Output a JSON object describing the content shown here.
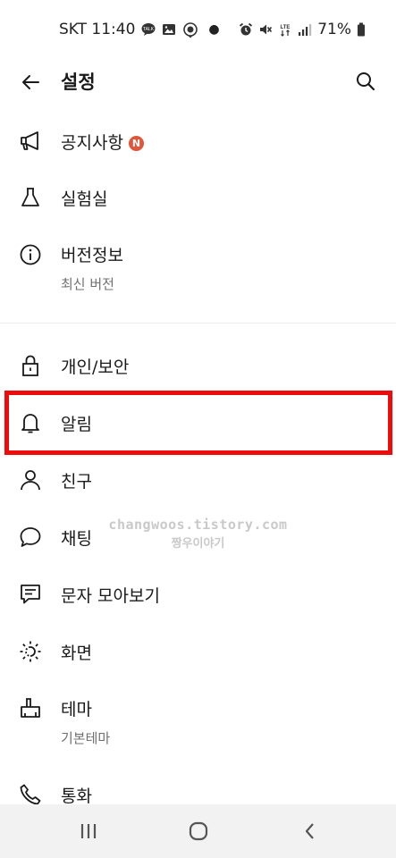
{
  "status_bar": {
    "carrier_time": "SKT 11:40",
    "battery": "71%",
    "notification_icons": [
      "talk-icon",
      "image-icon",
      "location-face-icon"
    ],
    "system_icons": [
      "alarm-icon",
      "mute-icon",
      "lte-icon",
      "signal-icon",
      "battery-icon"
    ]
  },
  "header": {
    "title": "설정"
  },
  "menu": {
    "notice": {
      "label": "공지사항",
      "badge": "N"
    },
    "lab": {
      "label": "실험실"
    },
    "version": {
      "label": "버전정보",
      "sub": "최신 버전"
    },
    "privacy": {
      "label": "개인/보안"
    },
    "alarm": {
      "label": "알림"
    },
    "friends": {
      "label": "친구"
    },
    "chat": {
      "label": "채팅"
    },
    "sms": {
      "label": "문자 모아보기"
    },
    "display": {
      "label": "화면"
    },
    "theme": {
      "label": "테마",
      "sub": "기본테마"
    },
    "call": {
      "label": "통화"
    }
  },
  "watermark": {
    "line1": "changwoos.tistory.com",
    "line2": "짱우이야기"
  },
  "colors": {
    "highlight": "#ee0b0b",
    "badge": "#e0563a"
  }
}
